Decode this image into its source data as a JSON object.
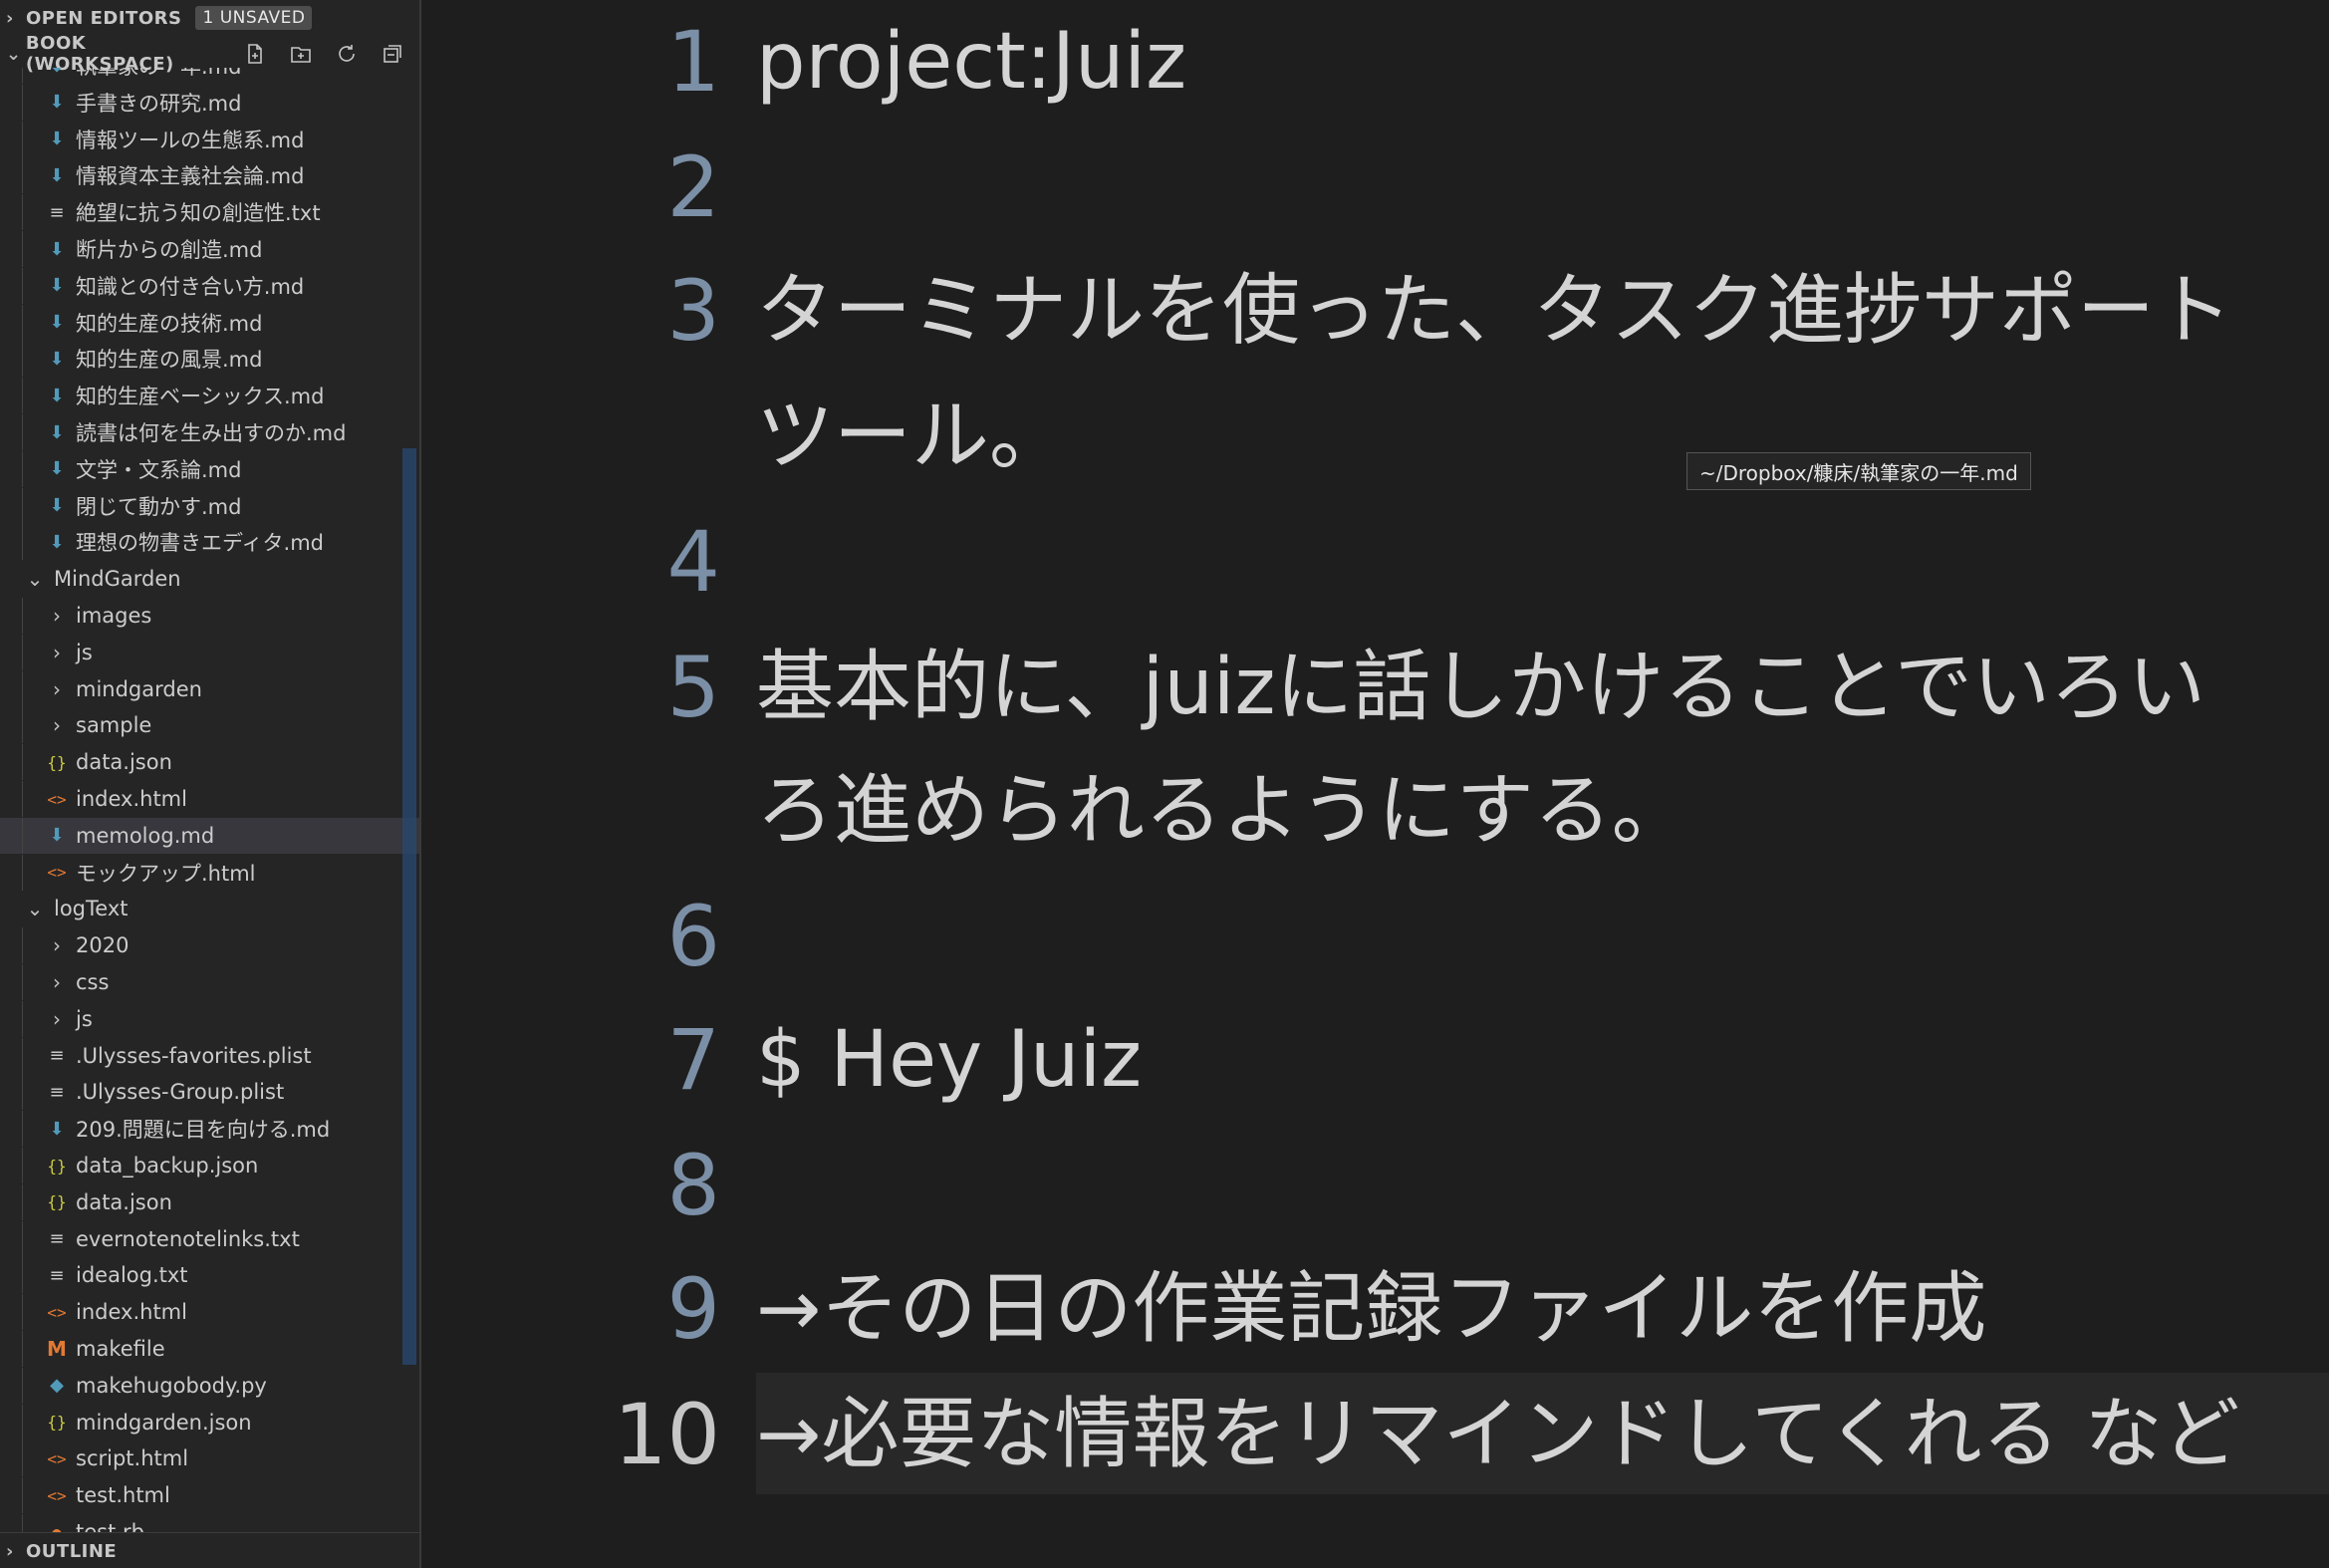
{
  "open_editors": {
    "title": "OPEN EDITORS",
    "badge": "1 UNSAVED"
  },
  "workspace": {
    "title": "BOOK (WORKSPACE)",
    "actions": [
      "new-file-icon",
      "new-folder-icon",
      "refresh-icon",
      "collapse-all-icon"
    ]
  },
  "tree": [
    {
      "label": "執筆家の一年.md",
      "icon": "md",
      "depth": 1
    },
    {
      "label": "手書きの研究.md",
      "icon": "md",
      "depth": 1
    },
    {
      "label": "情報ツールの生態系.md",
      "icon": "md",
      "depth": 1
    },
    {
      "label": "情報資本主義社会論.md",
      "icon": "md",
      "depth": 1
    },
    {
      "label": "絶望に抗う知の創造性.txt",
      "icon": "txt",
      "depth": 1
    },
    {
      "label": "断片からの創造.md",
      "icon": "md",
      "depth": 1
    },
    {
      "label": "知識との付き合い方.md",
      "icon": "md",
      "depth": 1
    },
    {
      "label": "知的生産の技術.md",
      "icon": "md",
      "depth": 1
    },
    {
      "label": "知的生産の風景.md",
      "icon": "md",
      "depth": 1
    },
    {
      "label": "知的生産ベーシックス.md",
      "icon": "md",
      "depth": 1
    },
    {
      "label": "読書は何を生み出すのか.md",
      "icon": "md",
      "depth": 1
    },
    {
      "label": "文学・文系論.md",
      "icon": "md",
      "depth": 1
    },
    {
      "label": "閉じて動かす.md",
      "icon": "md",
      "depth": 1
    },
    {
      "label": "理想の物書きエディタ.md",
      "icon": "md",
      "depth": 1
    },
    {
      "label": "MindGarden",
      "icon": "folder-open",
      "depth": 0
    },
    {
      "label": "images",
      "icon": "folder",
      "depth": 1
    },
    {
      "label": "js",
      "icon": "folder",
      "depth": 1
    },
    {
      "label": "mindgarden",
      "icon": "folder",
      "depth": 1
    },
    {
      "label": "sample",
      "icon": "folder",
      "depth": 1
    },
    {
      "label": "data.json",
      "icon": "json",
      "depth": 1
    },
    {
      "label": "index.html",
      "icon": "html",
      "depth": 1
    },
    {
      "label": "memolog.md",
      "icon": "md",
      "depth": 1,
      "selected": true
    },
    {
      "label": "モックアップ.html",
      "icon": "html",
      "depth": 1
    },
    {
      "label": "logText",
      "icon": "folder-open",
      "depth": 0
    },
    {
      "label": "2020",
      "icon": "folder",
      "depth": 1
    },
    {
      "label": "css",
      "icon": "folder",
      "depth": 1
    },
    {
      "label": "js",
      "icon": "folder",
      "depth": 1
    },
    {
      "label": ".Ulysses-favorites.plist",
      "icon": "txt",
      "depth": 1
    },
    {
      "label": ".Ulysses-Group.plist",
      "icon": "txt",
      "depth": 1
    },
    {
      "label": "209.問題に目を向ける.md",
      "icon": "md",
      "depth": 1
    },
    {
      "label": "data_backup.json",
      "icon": "json",
      "depth": 1
    },
    {
      "label": "data.json",
      "icon": "json",
      "depth": 1
    },
    {
      "label": "evernotenotelinks.txt",
      "icon": "txt",
      "depth": 1
    },
    {
      "label": "idealog.txt",
      "icon": "txt",
      "depth": 1
    },
    {
      "label": "index.html",
      "icon": "html",
      "depth": 1
    },
    {
      "label": "makefile",
      "icon": "make",
      "depth": 1
    },
    {
      "label": "makehugobody.py",
      "icon": "py",
      "depth": 1
    },
    {
      "label": "mindgarden.json",
      "icon": "json",
      "depth": 1
    },
    {
      "label": "script.html",
      "icon": "html",
      "depth": 1
    },
    {
      "label": "test.html",
      "icon": "html",
      "depth": 1
    },
    {
      "label": "test.rb",
      "icon": "rb",
      "depth": 1
    }
  ],
  "outline": {
    "title": "OUTLINE"
  },
  "editor": {
    "line_numbers": [
      "1",
      "2",
      "3",
      "4",
      "5",
      "6",
      "7",
      "8",
      "9",
      "10"
    ],
    "lines": [
      "project:Juiz",
      "",
      "ターミナルを使った、タスク進捗サポート",
      "ツール。",
      "",
      "基本的に、juizに話しかけることでいろい",
      "ろ進められるようにする。",
      "",
      "$ Hey Juiz",
      "",
      "→その日の作業記録ファイルを作成",
      "→必要な情報をリマインドしてくれる など"
    ]
  },
  "tooltip": "~/Dropbox/糠床/執筆家の一年.md"
}
